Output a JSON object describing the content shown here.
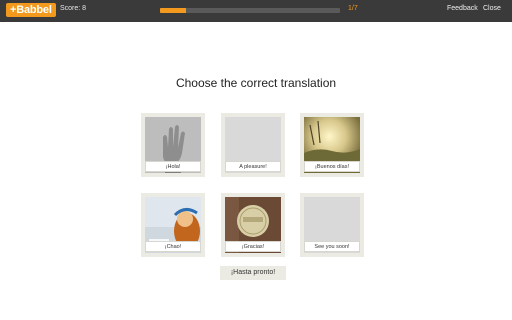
{
  "app": {
    "logo_text": "+Babbel",
    "score_text": "Score: 8"
  },
  "progress": {
    "current": 1,
    "total": 7,
    "label": "1/7"
  },
  "header": {
    "feedback_label": "Feedback",
    "close_label": "Close"
  },
  "exercise": {
    "prompt": "Choose the correct translation",
    "options": [
      {
        "label": "¡Hola!"
      },
      {
        "label": "A pleasure!"
      },
      {
        "label": "¡Buenos días!"
      },
      {
        "label": "¡Chao!"
      },
      {
        "label": "¡Gracias!"
      },
      {
        "label": "See you soon!"
      }
    ],
    "answer_chip": "¡Hasta pronto!"
  },
  "colors": {
    "brand": "#f39a1e",
    "topbar": "#3a3a3a",
    "card_bg": "#ecebe3"
  }
}
